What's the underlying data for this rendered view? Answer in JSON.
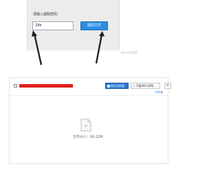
{
  "extract_dialog": {
    "prompt_label": "请输入提取密码：",
    "code_value": "29b",
    "extract_button_label": "提取文件"
  },
  "watermark": "Baidu经验",
  "file_view": {
    "save_button_label": "保存至网盘",
    "download_button_label": "下载(90.22M)",
    "more_button_label": "≡",
    "report_link_label": "分享者",
    "file_size_label": "文件大小：90.22M"
  },
  "colors": {
    "primary_blue": "#2d8de0",
    "redaction_red": "#e11e1e",
    "panel_gray": "#ececec",
    "arrow_dark": "#222222"
  },
  "icons": {
    "save": "folder-save-icon",
    "download": "download-icon",
    "file": "file-icon"
  }
}
